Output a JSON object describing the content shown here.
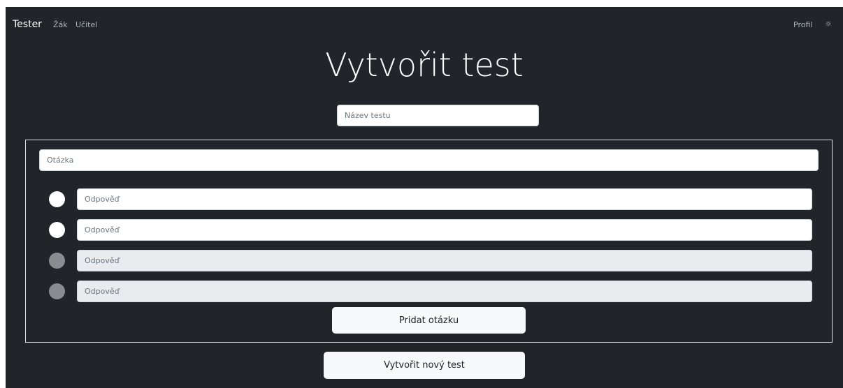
{
  "navbar": {
    "brand": "Tester",
    "links": [
      "Žák",
      "Učitel"
    ],
    "profile": "Profil",
    "theme_icon": "sun-icon",
    "theme_glyph": "☼"
  },
  "page": {
    "title": "Vytvořit test"
  },
  "form": {
    "test_name_placeholder": "Název testu",
    "question_placeholder": "Otázka",
    "answers": [
      {
        "placeholder": "Odpověď",
        "enabled": true
      },
      {
        "placeholder": "Odpověď",
        "enabled": true
      },
      {
        "placeholder": "Odpověď",
        "enabled": false
      },
      {
        "placeholder": "Odpověď",
        "enabled": false
      }
    ],
    "add_question_label": "Pridat otázku",
    "create_test_label": "Vytvořit nový test"
  },
  "colors": {
    "background": "#212529",
    "text": "#ffffff",
    "muted_text": "#adb5bd",
    "button_bg": "#f8f9fa",
    "disabled_input": "#e9ecef",
    "disabled_radio": "#8a8d90"
  }
}
